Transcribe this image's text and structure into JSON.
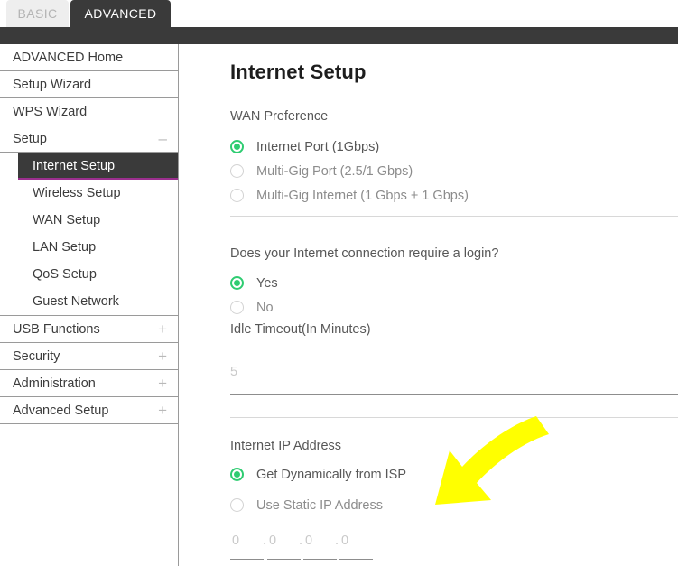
{
  "tabs": [
    {
      "label": "BASIC",
      "active": false
    },
    {
      "label": "ADVANCED",
      "active": true
    }
  ],
  "sidebar": {
    "items": [
      {
        "label": "ADVANCED Home",
        "toggle": ""
      },
      {
        "label": "Setup Wizard",
        "toggle": ""
      },
      {
        "label": "WPS Wizard",
        "toggle": ""
      },
      {
        "label": "Setup",
        "toggle": "–"
      }
    ],
    "submenu": [
      {
        "label": "Internet Setup",
        "active": true
      },
      {
        "label": "Wireless Setup",
        "active": false
      },
      {
        "label": "WAN Setup",
        "active": false
      },
      {
        "label": "LAN Setup",
        "active": false
      },
      {
        "label": "QoS Setup",
        "active": false
      },
      {
        "label": "Guest Network",
        "active": false
      }
    ],
    "items_after": [
      {
        "label": "USB Functions",
        "toggle": "+"
      },
      {
        "label": "Security",
        "toggle": "+"
      },
      {
        "label": "Administration",
        "toggle": "+"
      },
      {
        "label": "Advanced Setup",
        "toggle": "+"
      }
    ]
  },
  "main": {
    "title": "Internet Setup",
    "wan_preference": {
      "label": "WAN Preference",
      "options": [
        {
          "label": "Internet Port (1Gbps)",
          "selected": true
        },
        {
          "label": "Multi-Gig Port (2.5/1 Gbps)",
          "selected": false
        },
        {
          "label": "Multi-Gig Internet (1 Gbps + 1 Gbps)",
          "selected": false
        }
      ]
    },
    "login_question": {
      "label": "Does your Internet connection require a login?",
      "options": [
        {
          "label": "Yes",
          "selected": true
        },
        {
          "label": "No",
          "selected": false
        }
      ]
    },
    "idle_timeout": {
      "label": "Idle Timeout(In Minutes)",
      "value": "5"
    },
    "internet_ip": {
      "label": "Internet IP Address",
      "options": [
        {
          "label": "Get Dynamically from ISP",
          "selected": true
        },
        {
          "label": "Use Static IP Address",
          "selected": false
        }
      ],
      "octets": [
        "0",
        "0",
        "0",
        "0"
      ],
      "separator": "."
    }
  },
  "colors": {
    "accent_green": "#2ecc71",
    "active_purple": "#9b2f8e",
    "dark_bar": "#3a3a3a",
    "annotation_yellow": "#ffff00"
  }
}
